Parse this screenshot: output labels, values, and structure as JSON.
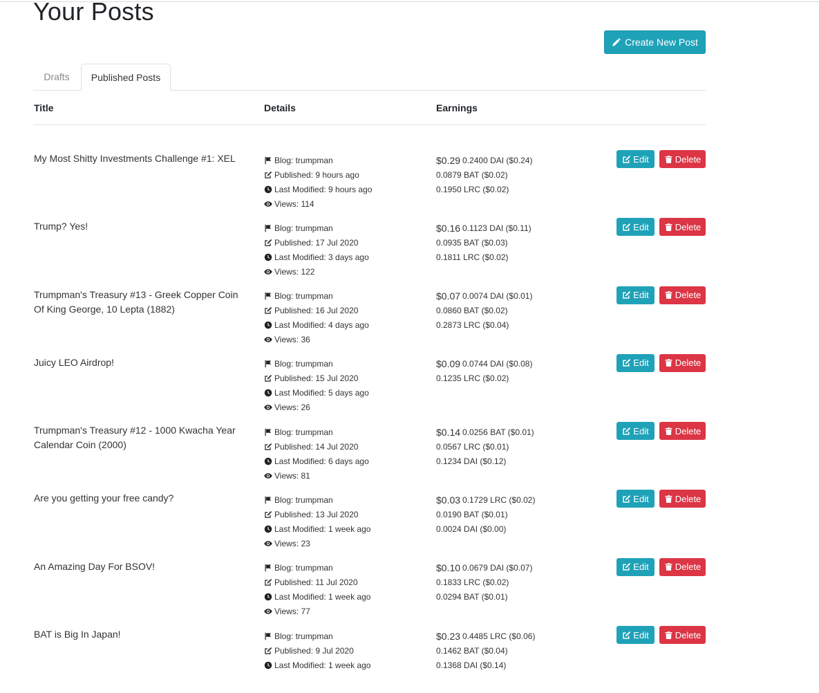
{
  "page": {
    "title": "Your Posts",
    "create_button": "Create New Post"
  },
  "tabs": [
    {
      "label": "Drafts"
    },
    {
      "label": "Published Posts"
    }
  ],
  "table": {
    "columns": [
      "Title",
      "Details",
      "Earnings"
    ],
    "actions": {
      "edit": "Edit",
      "delete": "Delete"
    },
    "rows": [
      {
        "title": "My Most Shitty Investments Challenge #1: XEL",
        "details": [
          "Blog: trumpman",
          "Published: 9 hours ago",
          "Last Modified: 9 hours ago",
          "Views: 114"
        ],
        "total": "$0.29",
        "earnings": [
          "0.2400 DAI ($0.24)",
          "0.0879 BAT ($0.02)",
          "0.1950 LRC ($0.02)"
        ]
      },
      {
        "title": "Trump? Yes!",
        "details": [
          "Blog: trumpman",
          "Published: 17 Jul 2020",
          "Last Modified: 3 days ago",
          "Views: 122"
        ],
        "total": "$0.16",
        "earnings": [
          "0.1123 DAI ($0.11)",
          "0.0935 BAT ($0.03)",
          "0.1811 LRC ($0.02)"
        ]
      },
      {
        "title": "Trumpman's Treasury #13 - Greek Copper Coin Of King George, 10 Lepta (1882)",
        "details": [
          "Blog: trumpman",
          "Published: 16 Jul 2020",
          "Last Modified: 4 days ago",
          "Views: 36"
        ],
        "total": "$0.07",
        "earnings": [
          "0.0074 DAI ($0.01)",
          "0.0860 BAT ($0.02)",
          "0.2873 LRC ($0.04)"
        ]
      },
      {
        "title": "Juicy LEO Airdrop!",
        "details": [
          "Blog: trumpman",
          "Published: 15 Jul 2020",
          "Last Modified: 5 days ago",
          "Views: 26"
        ],
        "total": "$0.09",
        "earnings": [
          "0.0744 DAI ($0.08)",
          "0.1235 LRC ($0.02)"
        ]
      },
      {
        "title": "Trumpman's Treasury #12 - 1000 Kwacha Year Calendar Coin (2000)",
        "details": [
          "Blog: trumpman",
          "Published: 14 Jul 2020",
          "Last Modified: 6 days ago",
          "Views: 81"
        ],
        "total": "$0.14",
        "earnings": [
          "0.0256 BAT ($0.01)",
          "0.0567 LRC ($0.01)",
          "0.1234 DAI ($0.12)"
        ]
      },
      {
        "title": "Are you getting your free candy?",
        "details": [
          "Blog: trumpman",
          "Published: 13 Jul 2020",
          "Last Modified: 1 week ago",
          "Views: 23"
        ],
        "total": "$0.03",
        "earnings": [
          "0.1729 LRC ($0.02)",
          "0.0190 BAT ($0.01)",
          "0.0024 DAI ($0.00)"
        ]
      },
      {
        "title": "An Amazing Day For BSOV!",
        "details": [
          "Blog: trumpman",
          "Published: 11 Jul 2020",
          "Last Modified: 1 week ago",
          "Views: 77"
        ],
        "total": "$0.10",
        "earnings": [
          "0.0679 DAI ($0.07)",
          "0.1833 LRC ($0.02)",
          "0.0294 BAT ($0.01)"
        ]
      },
      {
        "title": "BAT is Big In Japan!",
        "details": [
          "Blog: trumpman",
          "Published: 9 Jul 2020",
          "Last Modified: 1 week ago"
        ],
        "total": "$0.23",
        "earnings": [
          "0.4485 LRC ($0.06)",
          "0.1462 BAT ($0.04)",
          "0.1368 DAI ($0.14)"
        ]
      }
    ]
  },
  "icons": {
    "detail_icons": [
      "flag-icon",
      "edit-square-icon",
      "clock-icon",
      "eye-icon"
    ],
    "create": "pencil-icon",
    "edit": "edit-square-icon",
    "delete": "trash-icon"
  },
  "colors": {
    "info": "#1fa2b8",
    "danger": "#dc3545"
  }
}
